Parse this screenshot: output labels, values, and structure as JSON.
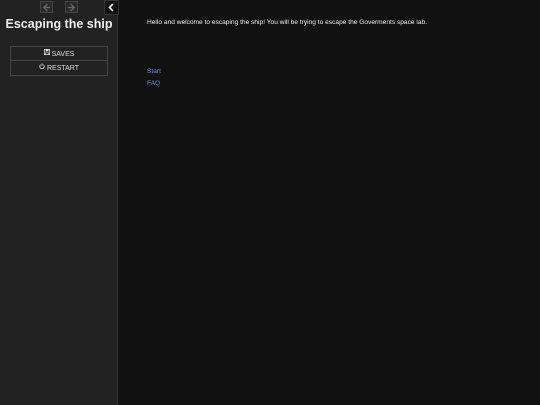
{
  "sidebar": {
    "nav": {
      "back_icon": "arrow-left-icon",
      "forward_icon": "arrow-right-icon",
      "collapse_icon": "chevron-left-icon"
    },
    "title": "Escaping the ship",
    "menu": [
      {
        "label": "SAVES",
        "icon": "floppy-disk-icon"
      },
      {
        "label": "RESTART",
        "icon": "power-icon"
      }
    ]
  },
  "passage": {
    "text": "Hello and welcome to escaping the ship! You will be trying to escape the Goverments space lab.",
    "links": [
      "Start",
      "FAQ"
    ]
  },
  "colors": {
    "background": "#111111",
    "sidebar": "#222222",
    "link": "#6688dd",
    "text": "#eeeeee"
  }
}
